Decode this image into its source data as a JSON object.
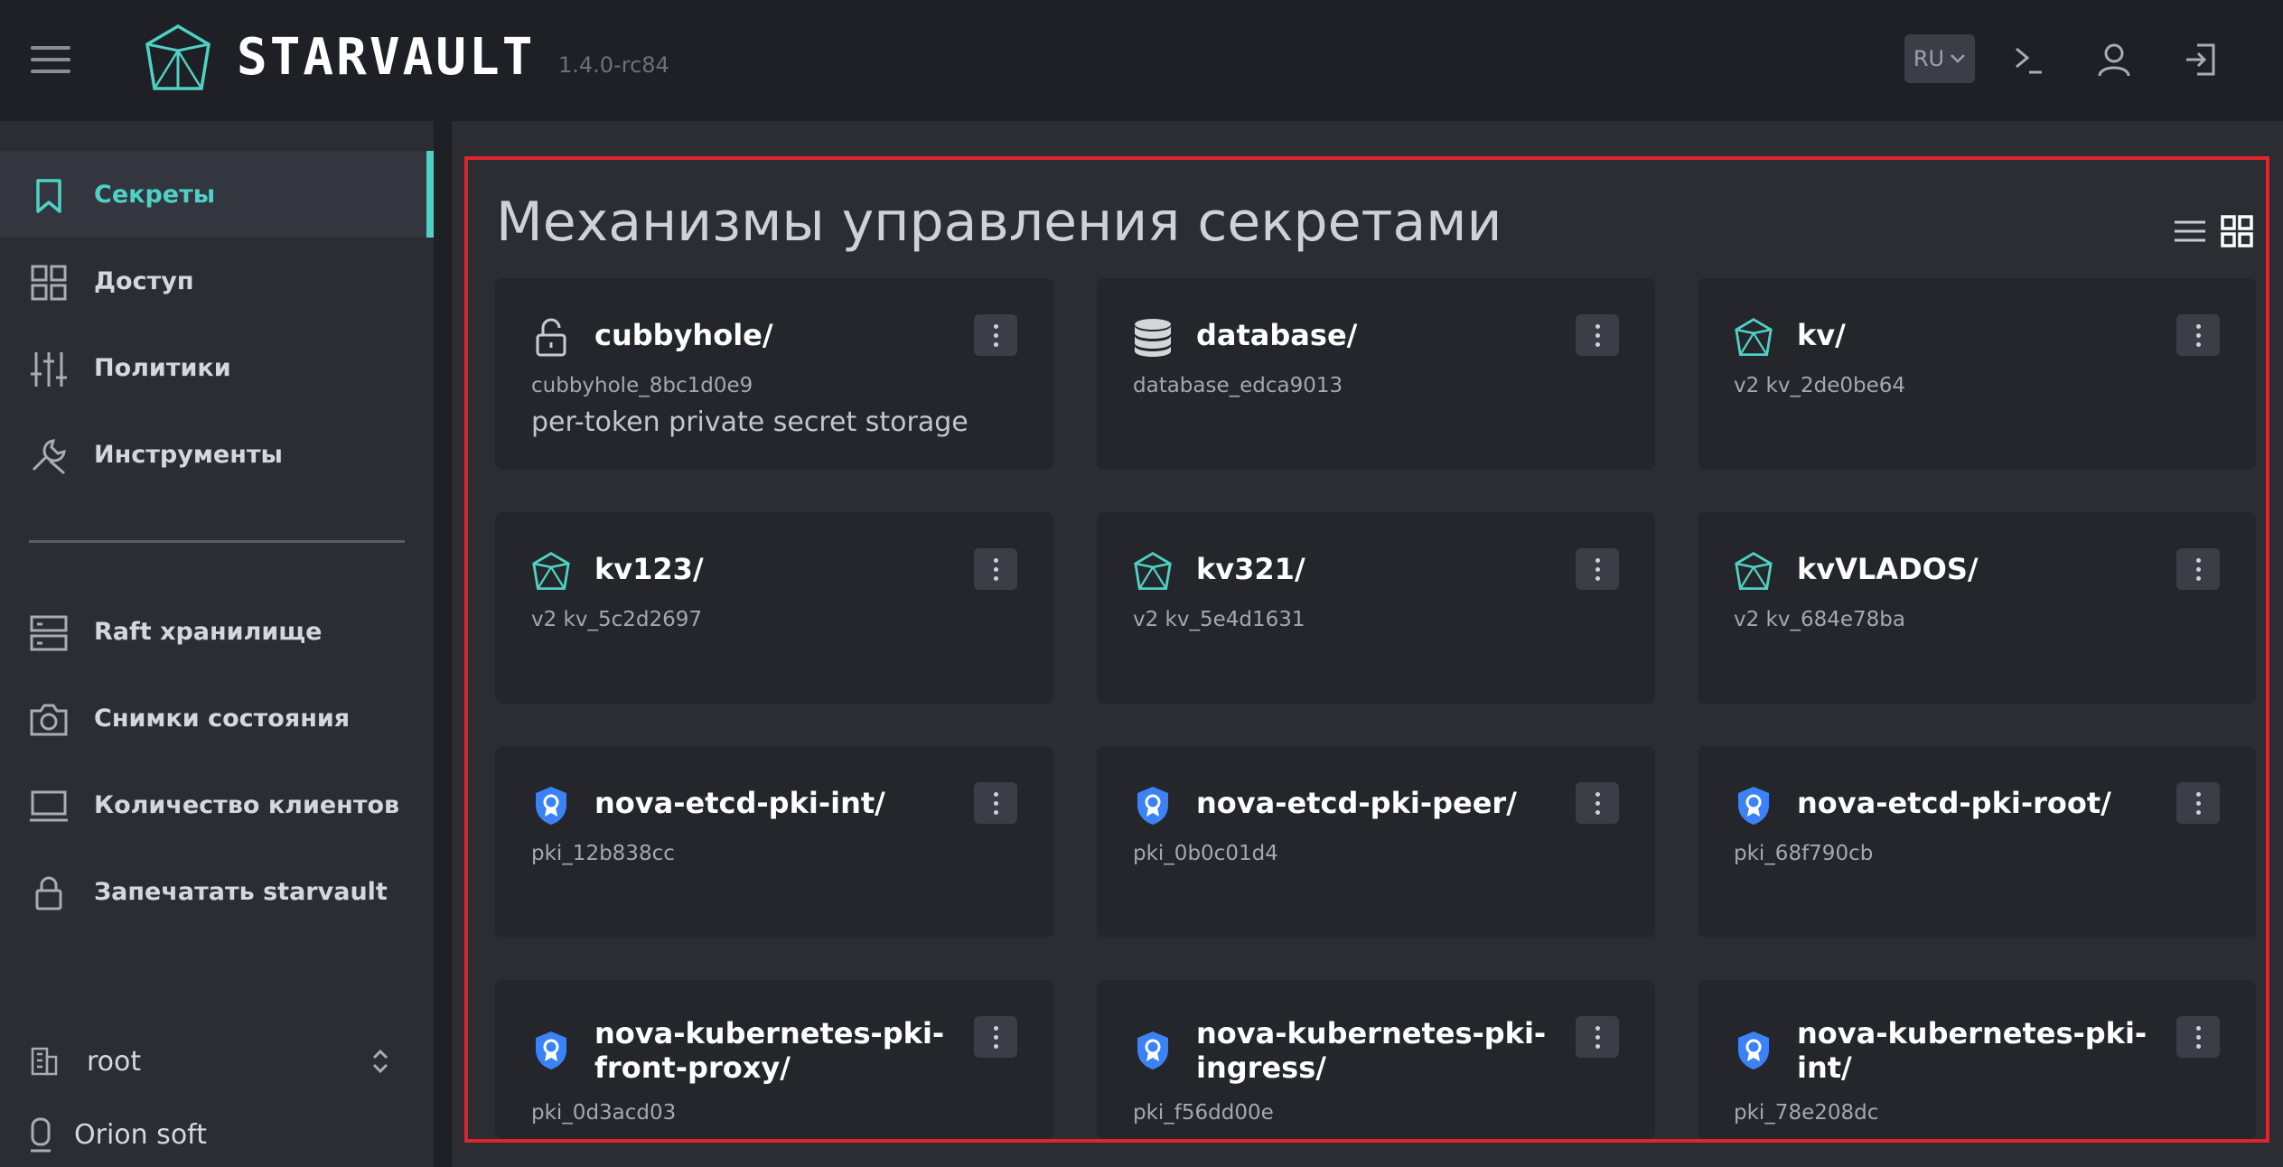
{
  "header": {
    "brand": "STARVAULT",
    "version": "1.4.0-rc84",
    "lang": "RU"
  },
  "sidebar": {
    "items": [
      {
        "label": "Секреты",
        "icon": "bookmark-icon"
      },
      {
        "label": "Доступ",
        "icon": "grid-icon"
      },
      {
        "label": "Политики",
        "icon": "sliders-icon"
      },
      {
        "label": "Инструменты",
        "icon": "wrench-icon"
      },
      {
        "label": "Raft хранилище",
        "icon": "server-icon"
      },
      {
        "label": "Снимки состояния",
        "icon": "camera-icon"
      },
      {
        "label": "Количество клиентов",
        "icon": "monitor-icon"
      },
      {
        "label": "Запечатать starvault",
        "icon": "lock-icon"
      }
    ],
    "namespace": "root",
    "org": "Orion soft"
  },
  "main": {
    "title": "Механизмы управления секретами",
    "cards": [
      {
        "name": "cubbyhole/",
        "id": "cubbyhole_8bc1d0e9",
        "desc": "per-token private secret storage",
        "icon": "unlock-icon"
      },
      {
        "name": "database/",
        "id": "database_edca9013",
        "icon": "database-icon"
      },
      {
        "name": "kv/",
        "id": "v2 kv_2de0be64",
        "icon": "kv-icon"
      },
      {
        "name": "kv123/",
        "id": "v2 kv_5c2d2697",
        "icon": "kv-icon"
      },
      {
        "name": "kv321/",
        "id": "v2 kv_5e4d1631",
        "icon": "kv-icon"
      },
      {
        "name": "kvVLADOS/",
        "id": "v2 kv_684e78ba",
        "icon": "kv-icon"
      },
      {
        "name": "nova-etcd-pki-int/",
        "id": "pki_12b838cc",
        "icon": "pki-badge-icon"
      },
      {
        "name": "nova-etcd-pki-peer/",
        "id": "pki_0b0c01d4",
        "icon": "pki-badge-icon"
      },
      {
        "name": "nova-etcd-pki-root/",
        "id": "pki_68f790cb",
        "icon": "pki-badge-icon"
      },
      {
        "name": "nova-kubernetes-pki-front-proxy/",
        "id": "pki_0d3acd03",
        "icon": "pki-badge-icon"
      },
      {
        "name": "nova-kubernetes-pki-ingress/",
        "id": "pki_f56dd00e",
        "icon": "pki-badge-icon"
      },
      {
        "name": "nova-kubernetes-pki-int/",
        "id": "pki_78e208dc",
        "icon": "pki-badge-icon"
      }
    ]
  },
  "colors": {
    "accent": "#4fd1c5",
    "header_bg": "#1f2026",
    "card_bg": "#24262c",
    "highlight_frame": "#e0242c",
    "pki_blue": "#3b82f6"
  }
}
